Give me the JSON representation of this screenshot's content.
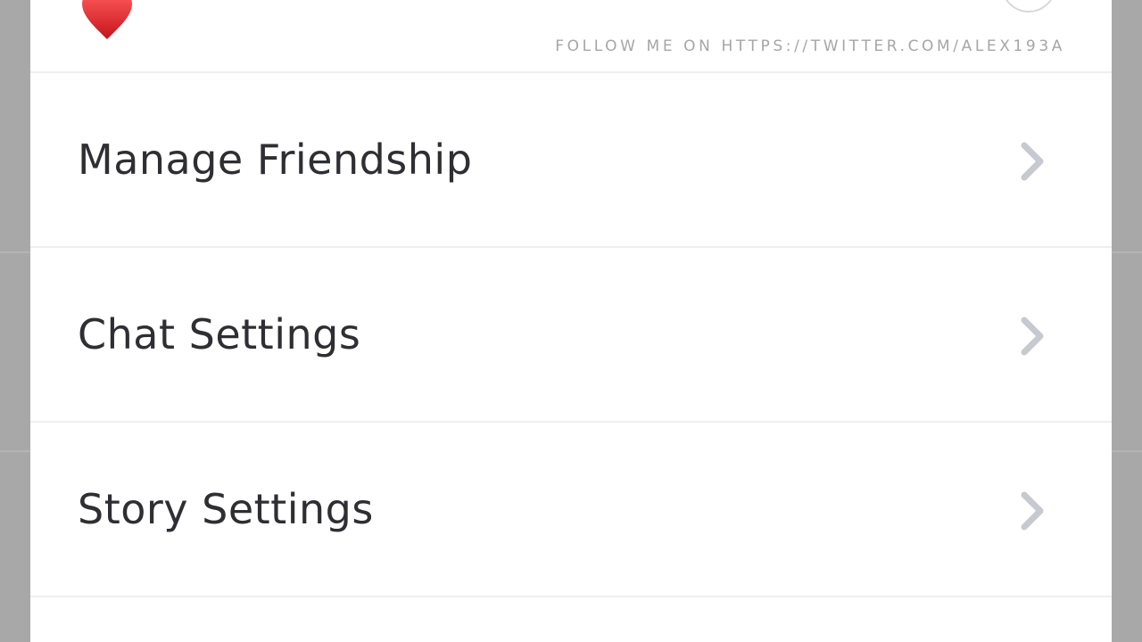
{
  "header": {
    "follow_text": "FOLLOW ME ON HTTPS://TWITTER.COM/ALEX193A",
    "heart_icon": "heart-icon",
    "heart_color": "#e0242a",
    "close_icon": "close-circle-icon"
  },
  "menu": {
    "items": [
      {
        "label": "Manage Friendship",
        "icon": "chevron-right-icon"
      },
      {
        "label": "Chat Settings",
        "icon": "chevron-right-icon"
      },
      {
        "label": "Story Settings",
        "icon": "chevron-right-icon"
      }
    ]
  },
  "colors": {
    "background": "#a8a8a8",
    "sheet": "#ffffff",
    "label_text": "#2e2e33",
    "chevron": "#c6c9cf",
    "follow_text": "#a6a6a6"
  }
}
